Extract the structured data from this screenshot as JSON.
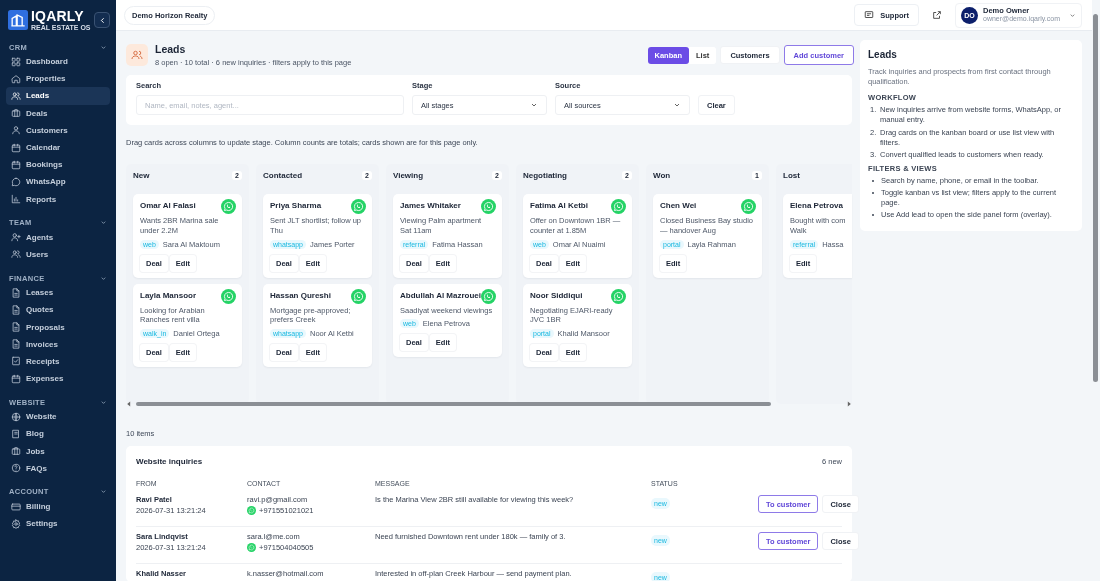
{
  "sidebar": {
    "logo": {
      "name": "IQARLY",
      "tagline": "REAL ESTATE OS"
    },
    "sections": [
      {
        "label": "CRM",
        "expanded": true,
        "items": [
          {
            "label": "Dashboard",
            "selected": false
          },
          {
            "label": "Properties",
            "selected": false
          },
          {
            "label": "Leads",
            "selected": true
          },
          {
            "label": "Deals",
            "selected": false
          },
          {
            "label": "Customers",
            "selected": false
          },
          {
            "label": "Calendar",
            "selected": false
          },
          {
            "label": "Bookings",
            "selected": false
          },
          {
            "label": "WhatsApp",
            "selected": false
          },
          {
            "label": "Reports",
            "selected": false
          }
        ]
      },
      {
        "label": "TEAM",
        "expanded": true,
        "items": [
          {
            "label": "Agents",
            "selected": false
          },
          {
            "label": "Users",
            "selected": false
          }
        ]
      },
      {
        "label": "FINANCE",
        "expanded": true,
        "items": [
          {
            "label": "Leases",
            "selected": false
          },
          {
            "label": "Quotes",
            "selected": false
          },
          {
            "label": "Proposals",
            "selected": false
          },
          {
            "label": "Invoices",
            "selected": false
          },
          {
            "label": "Receipts",
            "selected": false
          },
          {
            "label": "Expenses",
            "selected": false
          }
        ]
      },
      {
        "label": "WEBSITE",
        "expanded": true,
        "items": [
          {
            "label": "Website",
            "selected": false
          },
          {
            "label": "Blog",
            "selected": false
          },
          {
            "label": "Jobs",
            "selected": false
          },
          {
            "label": "FAQs",
            "selected": false
          }
        ]
      },
      {
        "label": "ACCOUNT",
        "expanded": true,
        "items": [
          {
            "label": "Billing",
            "selected": false
          },
          {
            "label": "Settings",
            "selected": false
          }
        ]
      }
    ]
  },
  "topbar": {
    "organization": "Demo Horizon Realty",
    "support": "Support",
    "user": {
      "initials": "DO",
      "name": "Demo Owner",
      "email": "owner@demo.iqarly.com"
    }
  },
  "header": {
    "title": "Leads",
    "subtitle": "8 open · 10 total · 6 new inquiries · filters apply to this page",
    "view_toggle": [
      {
        "label": "Kanban",
        "selected": true
      },
      {
        "label": "List",
        "selected": false
      }
    ],
    "buttons": [
      {
        "label": "Customers",
        "kind": "secondary"
      },
      {
        "label": "Add customer",
        "kind": "outline"
      }
    ]
  },
  "filters": {
    "search": {
      "label": "Search",
      "placeholder": "Name, email, notes, agent..."
    },
    "stage": {
      "label": "Stage",
      "value": "All stages"
    },
    "source": {
      "label": "Source",
      "value": "All sources"
    },
    "clear": "Clear"
  },
  "hint": "Drag cards across columns to update stage. Column counts are totals; cards shown are for this page only.",
  "kanban": {
    "columns": [
      {
        "title": "New",
        "count": "2",
        "cards": [
          {
            "name": "Omar Al Falasi",
            "message": "Wants 2BR Marina sale under 2.2M",
            "source": "web",
            "agent": "Sara Al Maktoum",
            "actions": [
              "Deal",
              "Edit"
            ]
          },
          {
            "name": "Layla Mansoor",
            "message": "Looking for Arabian Ranches rent villa",
            "source": "walk_in",
            "agent": "Daniel Ortega",
            "actions": [
              "Deal",
              "Edit"
            ]
          }
        ]
      },
      {
        "title": "Contacted",
        "count": "2",
        "cards": [
          {
            "name": "Priya Sharma",
            "message": "Sent JLT shortlist; follow up Thu",
            "source": "whatsapp",
            "agent": "James Porter",
            "actions": [
              "Deal",
              "Edit"
            ]
          },
          {
            "name": "Hassan Qureshi",
            "message": "Mortgage pre-approved; prefers Creek",
            "source": "whatsapp",
            "agent": "Noor Al Ketbi",
            "actions": [
              "Deal",
              "Edit"
            ]
          }
        ]
      },
      {
        "title": "Viewing",
        "count": "2",
        "cards": [
          {
            "name": "James Whitaker",
            "message": "Viewing Palm apartment Sat 11am",
            "source": "referral",
            "agent": "Fatima Hassan",
            "actions": [
              "Deal",
              "Edit"
            ]
          },
          {
            "name": "Abdullah Al Mazrouei",
            "message": "Saadiyat weekend viewings",
            "source": "web",
            "agent": "Elena Petrova",
            "actions": [
              "Deal",
              "Edit"
            ]
          }
        ]
      },
      {
        "title": "Negotiating",
        "count": "2",
        "cards": [
          {
            "name": "Fatima Al Ketbi",
            "message": "Offer on Downtown 1BR — counter at 1.85M",
            "source": "web",
            "agent": "Omar Al Nuaimi",
            "actions": [
              "Deal",
              "Edit"
            ]
          },
          {
            "name": "Noor Siddiqui",
            "message": "Negotiating EJARI-ready JVC 1BR",
            "source": "portal",
            "agent": "Khalid Mansoor",
            "actions": [
              "Deal",
              "Edit"
            ]
          }
        ]
      },
      {
        "title": "Won",
        "count": "1",
        "cards": [
          {
            "name": "Chen Wei",
            "message": "Closed Business Bay studio — handover Aug",
            "source": "portal",
            "agent": "Layla Rahman",
            "actions": [
              "Edit"
            ]
          }
        ]
      },
      {
        "title": "Lost",
        "cards": [
          {
            "name": "Elena Petrova",
            "message": "Bought with com\nWalk",
            "source": "referral",
            "agent": "Hassa",
            "actions": [
              "Edit"
            ],
            "whatsapp": false
          }
        ]
      }
    ]
  },
  "items_count": "10 items",
  "inquiries": {
    "title": "Website inquiries",
    "count": "6 new",
    "columns": [
      "FROM",
      "CONTACT",
      "MESSAGE",
      "STATUS"
    ],
    "rows": [
      {
        "from": "Ravi Patel",
        "date": "2026-07-31 13:21:24",
        "email": "ravi.p@gmail.com",
        "phone": "+971551021021",
        "message": "Is the Marina View 2BR still available for viewing this week?",
        "status": "new",
        "actions": [
          "To customer",
          "Close"
        ]
      },
      {
        "from": "Sara Lindqvist",
        "date": "2026-07-31 13:21:24",
        "email": "sara.l@me.com",
        "phone": "+971504040505",
        "message": "Need furnished Downtown rent under 180k — family of 3.",
        "status": "new",
        "actions": [
          "To customer",
          "Close"
        ]
      },
      {
        "from": "Khalid Nasser",
        "email": "k.nasser@hotmail.com",
        "message": "Interested in off-plan Creek Harbour — send payment plan.",
        "status": "new"
      }
    ]
  },
  "help": {
    "title": "Leads",
    "intro": "Track inquiries and prospects from first contact through qualification.",
    "sections": [
      {
        "heading": "WORKFLOW",
        "kind": "ordered",
        "items": [
          {
            "number": "1.",
            "text": "New inquiries arrive from website forms, WhatsApp, or manual entry."
          },
          {
            "number": "2.",
            "text": "Drag cards on the kanban board or use list view with filters."
          },
          {
            "number": "3.",
            "text": "Convert qualified leads to customers when ready."
          }
        ]
      },
      {
        "heading": "FILTERS & VIEWS",
        "kind": "bullets",
        "items": [
          {
            "text": "Search by name, phone, or email in the toolbar."
          },
          {
            "text": "Toggle kanban vs list view; filters apply to the current page."
          },
          {
            "text": "Use Add lead to open the side panel form (overlay)."
          }
        ]
      }
    ]
  }
}
